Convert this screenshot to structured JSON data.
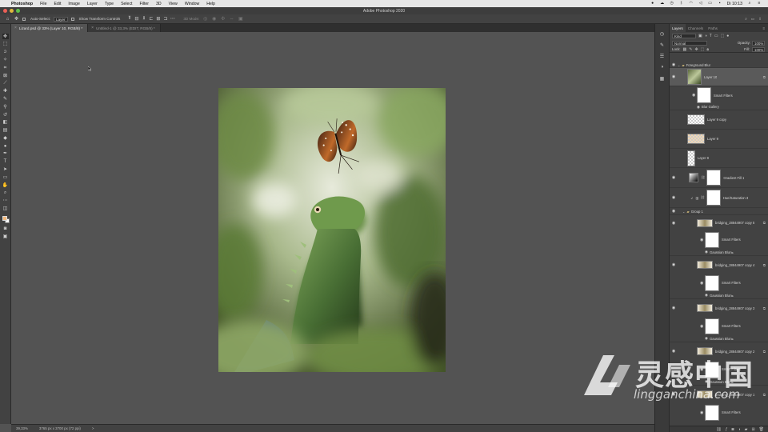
{
  "menubar": {
    "app_name": "Photoshop",
    "items": [
      "File",
      "Edit",
      "Image",
      "Layer",
      "Type",
      "Select",
      "Filter",
      "3D",
      "View",
      "Window",
      "Help"
    ],
    "clock": "Di 10:13"
  },
  "window": {
    "title": "Adobe Photoshop 2020"
  },
  "options_bar": {
    "auto_select_label": "Auto-Select:",
    "auto_select_value": "Layer",
    "show_transform_label": "Show Transform Controls",
    "mode_3d_label": "3D Mode:"
  },
  "tabs": [
    {
      "label": "Lizard.psd @ 33% (Layer 10, RGB/8) *",
      "active": true
    },
    {
      "label": "Untitled-1 @ 33,3% (EDIT, RGB/8) *",
      "active": false
    }
  ],
  "status": {
    "zoom": "39,33%",
    "doc_size": "3765 px x 3700 px (72 ppi)",
    "arrow": ">"
  },
  "colors": {
    "foreground": "#f2b97c",
    "background": "#ffffff"
  },
  "layers_panel": {
    "tabs": [
      "Layers",
      "Channels",
      "Paths"
    ],
    "filter_label": "Kind",
    "blend_mode": "Normal",
    "opacity_label": "Opacity:",
    "opacity_value": "100%",
    "lock_label": "Lock:",
    "fill_label": "Fill:",
    "fill_value": "100%",
    "layers": [
      {
        "name": "Foreground Blur",
        "kind": "group"
      },
      {
        "name": "Layer 10",
        "kind": "smart"
      },
      {
        "name": "Smart Filters",
        "kind": "filters"
      },
      {
        "name": "Blur Gallery",
        "kind": "filter-item"
      },
      {
        "name": "Layer 9 copy",
        "kind": "pixel"
      },
      {
        "name": "Layer 9",
        "kind": "pixel"
      },
      {
        "name": "Layer 8",
        "kind": "pixel"
      },
      {
        "name": "Gradient Fill 1",
        "kind": "adjust"
      },
      {
        "name": "Hue/Saturation 3",
        "kind": "adjust"
      },
      {
        "name": "Group 1",
        "kind": "group"
      },
      {
        "name": "bridging_28844907 copy 5",
        "kind": "smart"
      },
      {
        "name": "Smart Filters",
        "kind": "filters"
      },
      {
        "name": "Gaussian Blur",
        "kind": "filter-item"
      },
      {
        "name": "bridging_28844907 copy 4",
        "kind": "smart"
      },
      {
        "name": "Smart Filters",
        "kind": "filters"
      },
      {
        "name": "Gaussian Blur",
        "kind": "filter-item"
      },
      {
        "name": "bridging_28844907 copy 3",
        "kind": "smart"
      },
      {
        "name": "Smart Filters",
        "kind": "filters"
      },
      {
        "name": "Gaussian Blur",
        "kind": "filter-item"
      },
      {
        "name": "bridging_28844907 copy 2",
        "kind": "smart"
      },
      {
        "name": "Smart Filters",
        "kind": "filters"
      },
      {
        "name": "Gaussian Blur",
        "kind": "filter-item"
      },
      {
        "name": "bridging_28844907 copy 1",
        "kind": "smart"
      },
      {
        "name": "Smart Filters",
        "kind": "filters"
      }
    ]
  },
  "watermark": {
    "name": "灵感中国",
    "url": "lingganchina.com"
  }
}
